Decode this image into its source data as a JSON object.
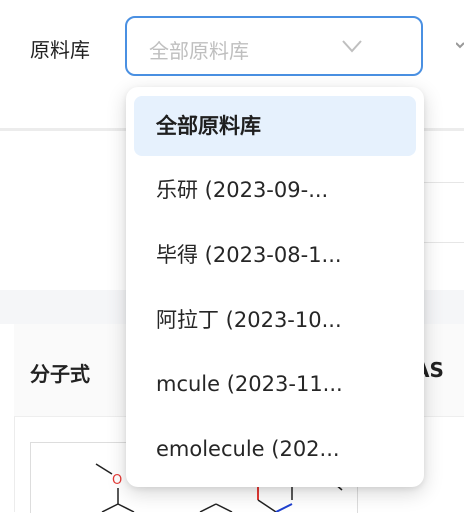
{
  "filter": {
    "label": "原料库",
    "select_value": "全部原料库"
  },
  "dropdown": {
    "options": [
      {
        "label": "全部原料库",
        "selected": true
      },
      {
        "label": "乐研 (2023-09-..."
      },
      {
        "label": "毕得 (2023-08-1..."
      },
      {
        "label": "阿拉丁 (2023-10..."
      },
      {
        "label": "mcule (2023-11..."
      },
      {
        "label": "emolecule (202..."
      }
    ]
  },
  "table": {
    "col_formula": "分子式",
    "col_cas": "AS"
  },
  "molecule": {
    "atom_o": "O"
  },
  "colors": {
    "select_border": "#4a90e2",
    "selected_option_bg": "#e6f1fd",
    "placeholder": "#bfbfbf",
    "oxygen": "#e53935",
    "nitrogen": "#1e40d0"
  }
}
